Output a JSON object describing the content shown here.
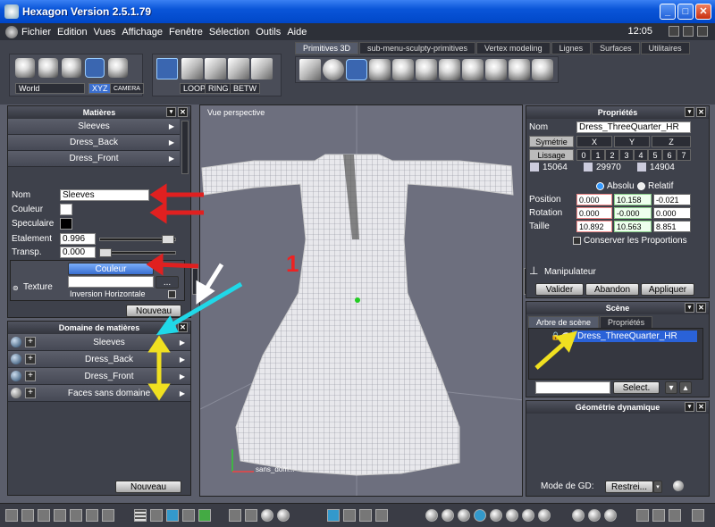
{
  "app": {
    "title": "Hexagon Version 2.5.1.79",
    "clock": "12:05"
  },
  "menu": [
    "Fichier",
    "Edition",
    "Vues",
    "Affichage",
    "Fenêtre",
    "Sélection",
    "Outils",
    "Aide"
  ],
  "toolbar": {
    "space_select": "World",
    "xyz": "XYZ",
    "camera": "CAMERA",
    "loop": "LOOP",
    "ring": "RING",
    "betw": "BETW",
    "tabs": [
      "Primitives 3D",
      "sub-menu-sculpty-primitives",
      "Vertex modeling",
      "Lignes",
      "Surfaces",
      "Utilitaires"
    ]
  },
  "materials": {
    "title": "Matières",
    "items": [
      "Sleeves",
      "Dress_Back",
      "Dress_Front"
    ],
    "nom_label": "Nom",
    "nom_value": "Sleeves",
    "couleur_label": "Couleur",
    "speculaire_label": "Speculaire",
    "etalement_label": "Etalement",
    "etalement_value": "0.996",
    "transp_label": "Transp.",
    "transp_value": "0.000",
    "texture_label": "Texture",
    "texture_dropdown": "Couleur",
    "texture_btn": "...",
    "inversion_label": "Inversion Horizontale",
    "nouveau": "Nouveau",
    "colors": {
      "couleur": "#ffffff",
      "speculaire": "#000000"
    }
  },
  "domain": {
    "title": "Domaine de matières",
    "items": [
      "Sleeves",
      "Dress_Back",
      "Dress_Front",
      "Faces sans domaine"
    ],
    "nouveau": "Nouveau"
  },
  "viewport": {
    "title": "Vue perspective",
    "annotation": "1",
    "object_label": "sans_dom..."
  },
  "properties": {
    "title": "Propriétés",
    "object_name": "Dress_ThreeQuarter_HR",
    "symetrie": "Symétrie",
    "axes": [
      "X",
      "Y",
      "Z"
    ],
    "lissage": "Lissage",
    "lissage_levels": [
      "0",
      "1",
      "2",
      "3",
      "4",
      "5",
      "6",
      "7"
    ],
    "counts": [
      "15064",
      "29970",
      "14904"
    ],
    "absolu": "Absolu",
    "relatif": "Relatif",
    "rows": [
      {
        "label": "Position",
        "values": [
          "0.000",
          "10.158",
          "-0.021"
        ]
      },
      {
        "label": "Rotation",
        "values": [
          "0.000",
          "-0.000",
          "0.000"
        ]
      },
      {
        "label": "Taille",
        "values": [
          "10.892",
          "10.563",
          "8.851"
        ]
      }
    ],
    "conserver": "Conserver les Proportions",
    "manipulateur": "Manipulateur",
    "valider": "Valider",
    "abandon": "Abandon",
    "appliquer": "Appliquer"
  },
  "scene": {
    "title": "Scène",
    "tabs": [
      "Arbre de scène",
      "Propriétés"
    ],
    "item": "Dress_ThreeQuarter_HR",
    "select_btn": "Select."
  },
  "geo": {
    "title": "Géométrie dynamique",
    "mode_label": "Mode de GD:",
    "mode_value": "Restrei..."
  }
}
